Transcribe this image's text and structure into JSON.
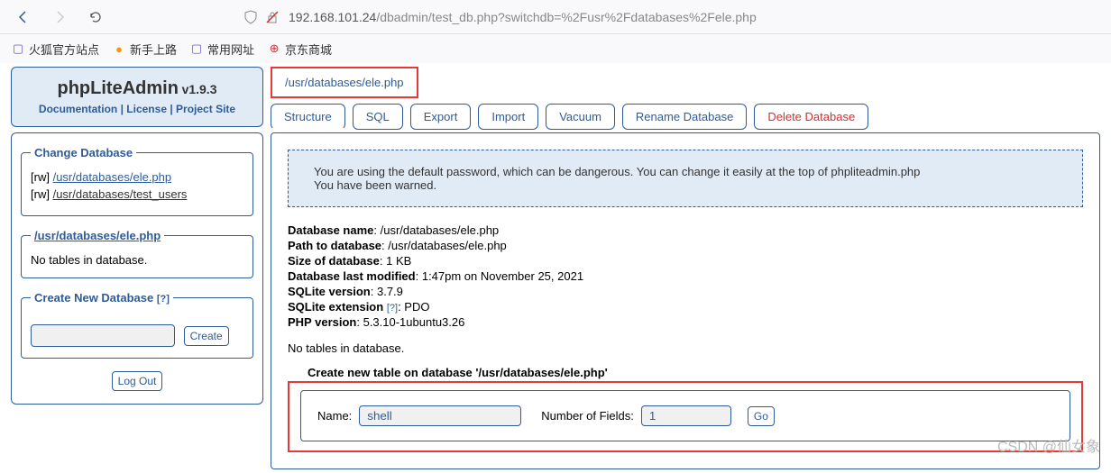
{
  "browser": {
    "url_host": "192.168.101.24",
    "url_path": "/dbadmin/test_db.php?switchdb=%2Fusr%2Fdatabases%2Fele.php"
  },
  "bookmarks": [
    {
      "icon": "folder",
      "label": "火狐官方站点",
      "color": "#6a5acd"
    },
    {
      "icon": "firefox",
      "label": "新手上路",
      "color": "#ff9500"
    },
    {
      "icon": "folder",
      "label": "常用网址",
      "color": "#6a5acd"
    },
    {
      "icon": "globe",
      "label": "京东商城",
      "color": "#d32f2f"
    }
  ],
  "app": {
    "title": "phpLiteAdmin",
    "version": "v1.9.3",
    "links": {
      "doc": "Documentation",
      "license": "License",
      "project": "Project Site"
    }
  },
  "sidebar": {
    "change_db_legend": "Change Database",
    "databases": [
      {
        "perm": "[rw]",
        "path": "/usr/databases/ele.php"
      },
      {
        "perm": "[rw]",
        "path": "/usr/databases/test_users"
      }
    ],
    "current_db_path": "/usr/databases/ele.php",
    "no_tables": "No tables in database.",
    "create_legend": "Create New Database",
    "create_btn": "Create",
    "logout_btn": "Log Out",
    "help": "[?]"
  },
  "main": {
    "path": "/usr/databases/ele.php",
    "tabs": {
      "structure": "Structure",
      "sql": "SQL",
      "export": "Export",
      "import": "Import",
      "vacuum": "Vacuum",
      "rename": "Rename Database",
      "delete": "Delete Database"
    },
    "warning_line1": "You are using the default password, which can be dangerous. You can change it easily at the top of phpliteadmin.php",
    "warning_line2": "You have been warned.",
    "info": {
      "db_name_label": "Database name",
      "db_name": ": /usr/databases/ele.php",
      "path_label": "Path to database",
      "path": ": /usr/databases/ele.php",
      "size_label": "Size of database",
      "size": ": 1 KB",
      "modified_label": "Database last modified",
      "modified": ": 1:47pm on November 25, 2021",
      "sqlite_ver_label": "SQLite version",
      "sqlite_ver": ": 3.7.9",
      "sqlite_ext_label": "SQLite extension",
      "sqlite_ext": ": PDO",
      "php_ver_label": "PHP version",
      "php_ver": ": 5.3.10-1ubuntu3.26"
    },
    "no_tables": "No tables in database.",
    "create_table": {
      "legend": "Create new table on database '/usr/databases/ele.php'",
      "name_label": "Name:",
      "name_value": "shell",
      "fields_label": "Number of Fields:",
      "fields_value": "1",
      "go_btn": "Go"
    }
  },
  "watermark": "CSDN @仙女象"
}
